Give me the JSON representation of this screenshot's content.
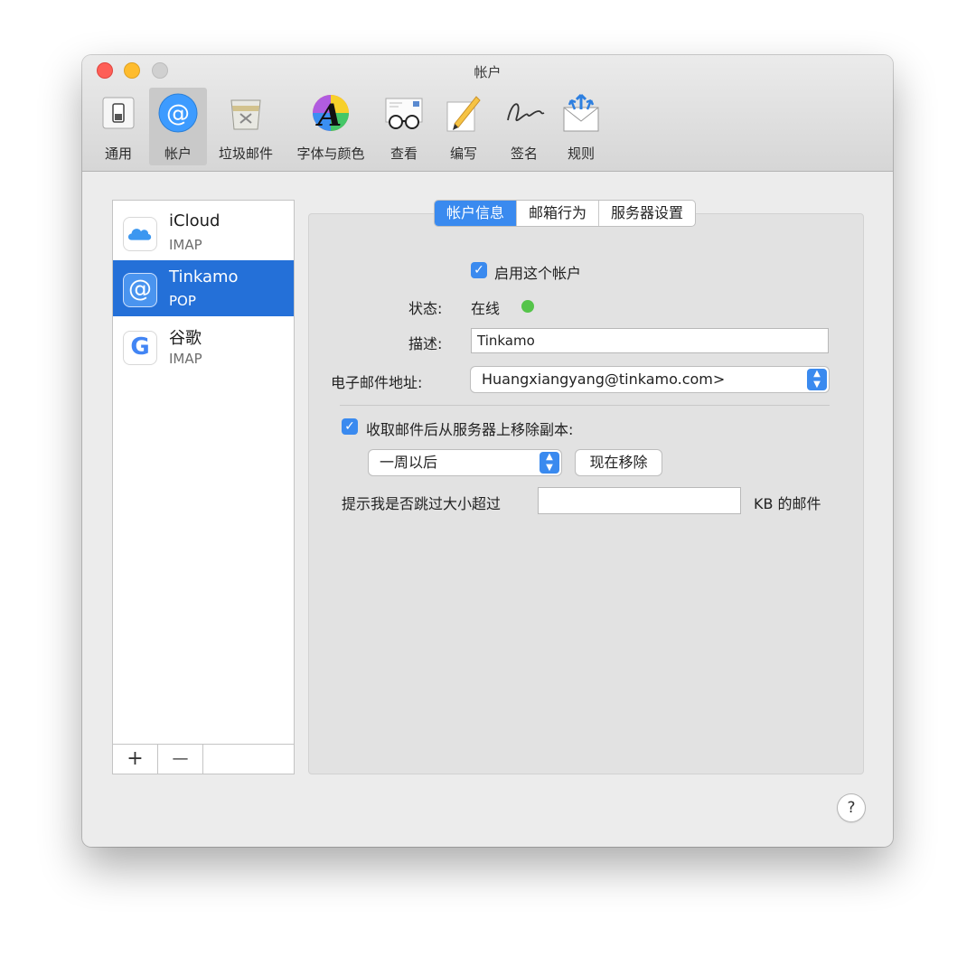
{
  "window": {
    "title": "帐户"
  },
  "toolbar": {
    "items": [
      {
        "label": "通用",
        "icon": "switch-icon"
      },
      {
        "label": "帐户",
        "icon": "at-sign-icon"
      },
      {
        "label": "垃圾邮件",
        "icon": "trash-icon"
      },
      {
        "label": "字体与颜色",
        "icon": "font-color-icon"
      },
      {
        "label": "查看",
        "icon": "glasses-icon"
      },
      {
        "label": "编写",
        "icon": "pencil-icon"
      },
      {
        "label": "签名",
        "icon": "signature-icon"
      },
      {
        "label": "规则",
        "icon": "mail-rules-icon"
      }
    ],
    "font_icon_letter": "A"
  },
  "accounts": [
    {
      "name": "iCloud",
      "type": "IMAP",
      "icon": "cloud-icon"
    },
    {
      "name": "Tinkamo",
      "type": "POP",
      "icon": "at-sign-icon",
      "selected": true
    },
    {
      "name": "谷歌",
      "type": "IMAP",
      "icon": "google-icon",
      "glyph": "G"
    }
  ],
  "list_buttons": {
    "add": "+",
    "remove": "—"
  },
  "tabs": [
    "帐户信息",
    "邮箱行为",
    "服务器设置"
  ],
  "form": {
    "enable_label": "启用这个帐户",
    "status_label": "状态:",
    "status_value": "在线",
    "status_color": "#55c44a",
    "desc_label": "描述:",
    "desc_value": "Tinkamo",
    "email_label": "电子邮件地址:",
    "email_value": "Huangxiangyang@tinkamo.com>",
    "remove_copy_label": "收取邮件后从服务器上移除副本:",
    "period_value": "一周以后",
    "remove_now": "现在移除",
    "size_prompt": "提示我是否跳过大小超过",
    "size_value": "",
    "size_unit": "KB 的邮件"
  },
  "help": "?",
  "colors": {
    "accent": "#3a8aef",
    "selection": "#2470d8"
  }
}
